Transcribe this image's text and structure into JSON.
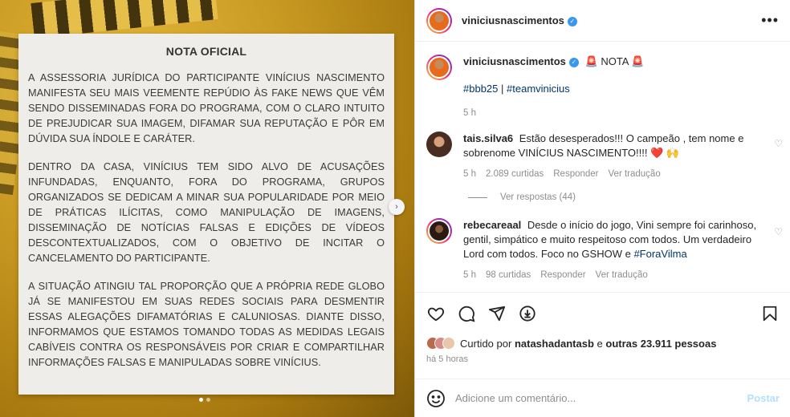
{
  "note": {
    "title": "NOTA OFICIAL",
    "paragraphs": [
      "A assessoria jurídica do participante Vinícius Nascimento manifesta seu mais veemente repúdio às fake news que vêm sendo disseminadas fora do programa, com o claro intuito de prejudicar sua imagem, difamar sua reputação e pôr em dúvida sua índole e caráter.",
      "Dentro da casa, Vinícius tem sido alvo de acusações infundadas, enquanto, fora do programa, grupos organizados se dedicam a minar sua popularidade por meio de práticas ilícitas, como manipulação de imagens, disseminação de notícias falsas e edições de vídeos descontextualizados, com o objetivo de incitar o cancelamento do participante.",
      "A situação atingiu tal proporção que a própria Rede Globo já se manifestou em suas redes sociais para desmentir essas alegações difamatórias e caluniosas. Diante disso, informamos que estamos tomando todas as medidas legais cabíveis contra os responsáveis por criar e compartilhar informações falsas e manipuladas sobre Vinícius."
    ]
  },
  "header": {
    "username": "viniciusnascimentos",
    "more": "•••"
  },
  "caption": {
    "username": "viniciusnascimentos",
    "text": "🚨 NOTA 🚨",
    "hashtag1": "#bbb25",
    "sep": "|",
    "hashtag2": "#teamvinicius",
    "time": "5 h"
  },
  "comments": [
    {
      "username": "tais.silva6",
      "text": "Estão desesperados!!! O campeão , tem nome e sobrenome VINÍCIUS NASCIMENTO!!!! ❤️ 🙌",
      "time": "5 h",
      "likes": "2.089 curtidas",
      "reply": "Responder",
      "translate": "Ver tradução",
      "view_replies": "Ver respostas (44)"
    },
    {
      "username": "rebecareaal",
      "text": "Desde o início do jogo, Vini sempre foi carinhoso, gentil, simpático e muito respeitoso com todos. Um verdadeiro Lord com todos. Foco no GSHOW e",
      "hashtag": "#ForaVilma",
      "time": "5 h",
      "likes": "98 curtidas",
      "reply": "Responder",
      "translate": "Ver tradução"
    }
  ],
  "likes": {
    "prefix": "Curtido por",
    "user": "natashadantasb",
    "mid": "e",
    "others": "outras 23.911 pessoas"
  },
  "timeago": "há 5 horas",
  "add_comment": {
    "placeholder": "Adicione um comentário...",
    "post": "Postar"
  }
}
